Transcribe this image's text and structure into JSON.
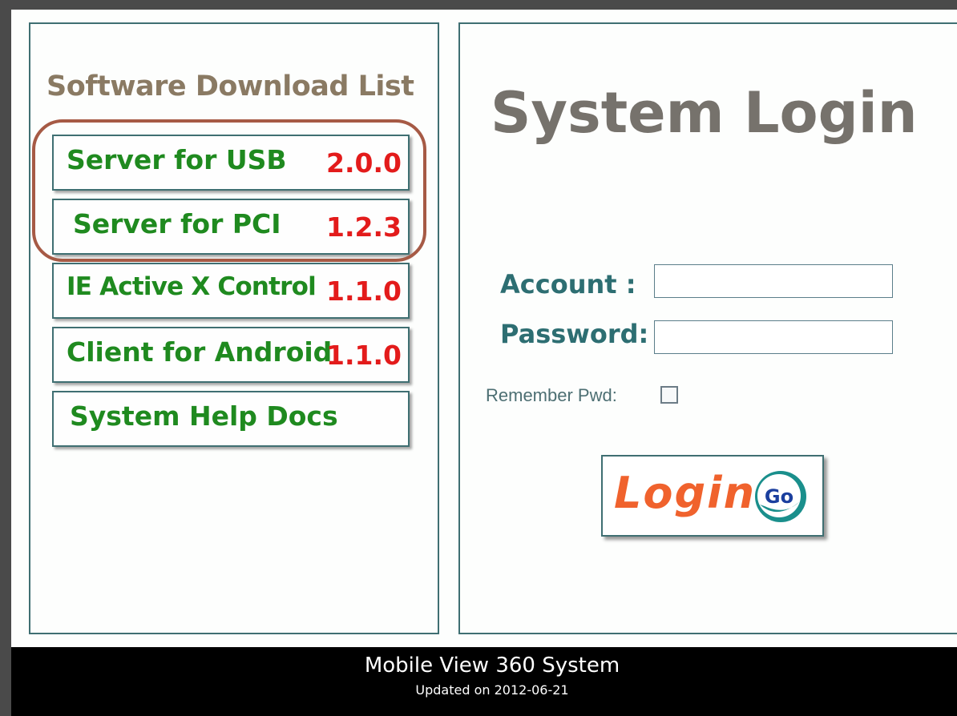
{
  "download_list": {
    "title": "Software Download List",
    "items": [
      {
        "name": "Server for USB",
        "version": "2.0.0"
      },
      {
        "name": "Server for PCI",
        "version": "1.2.3"
      },
      {
        "name": "IE Active X Control",
        "version": "1.1.0"
      },
      {
        "name": "Client for Android",
        "version": "1.1.0"
      },
      {
        "name": "System Help Docs",
        "version": ""
      }
    ]
  },
  "login": {
    "title": "System Login",
    "account_label": "Account  :",
    "account_value": "",
    "password_label": "Password:",
    "password_value": "",
    "remember_label": "Remember Pwd:",
    "remember_checked": false,
    "button_label": "Login",
    "go_badge": "Go"
  },
  "footer": {
    "title": "Mobile View 360 System",
    "subtitle": "Updated on 2012-06-21"
  },
  "colors": {
    "item_text": "#1f8a1f",
    "version_text": "#e31b1b",
    "highlight_ring": "#a65a45",
    "label_text": "#2d6e72",
    "login_word": "#f0622d",
    "panel_border": "#3f6f72"
  }
}
